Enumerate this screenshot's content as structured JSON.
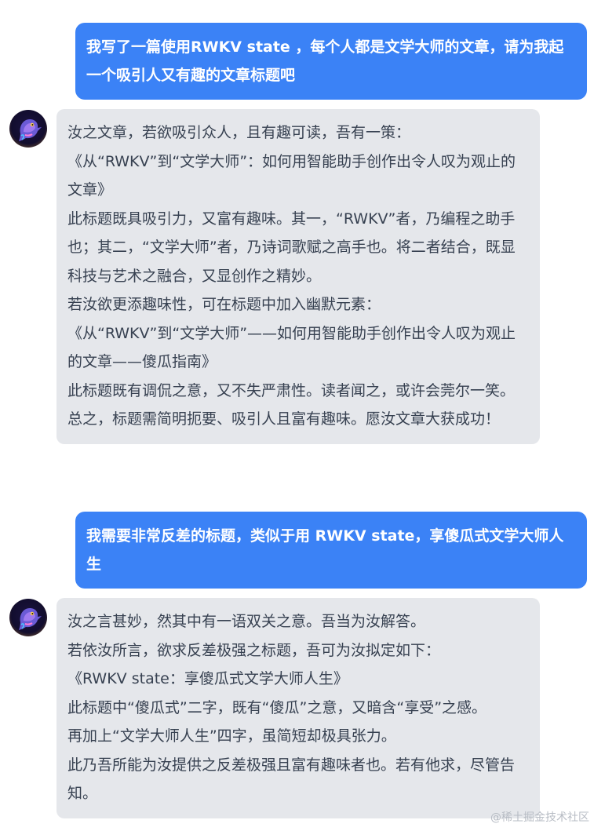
{
  "conversation": {
    "messages": [
      {
        "role": "user",
        "lines": [
          "我写了一篇使用RWKV state ，每个人都是文学大师的文章，请为我起一个吸引人又有趣的文章标题吧"
        ]
      },
      {
        "role": "assistant",
        "avatar_icon": "bird-avatar-icon",
        "lines": [
          "汝之文章，若欲吸引众人，且有趣可读，吾有一策：",
          "《从“RWKV”到“文学大师”：如何用智能助手创作出令人叹为观止的文章》",
          "此标题既具吸引力，又富有趣味。其一，“RWKV”者，乃编程之助手也；其二，“文学大师”者，乃诗词歌赋之高手也。将二者结合，既显科技与艺术之融合，又显创作之精妙。",
          "若汝欲更添趣味性，可在标题中加入幽默元素：",
          "《从“RWKV”到“文学大师”——如何用智能助手创作出令人叹为观止的文章——傻瓜指南》",
          "此标题既有调侃之意，又不失严肃性。读者闻之，或许会莞尔一笑。",
          "总之，标题需简明扼要、吸引人且富有趣味。愿汝文章大获成功！"
        ]
      },
      {
        "role": "user",
        "lines": [
          "我需要非常反差的标题，类似于用 RWKV state，享傻瓜式文学大师人生"
        ]
      },
      {
        "role": "assistant",
        "avatar_icon": "bird-avatar-icon",
        "lines": [
          "汝之言甚妙，然其中有一语双关之意。吾当为汝解答。",
          "若依汝所言，欲求反差极强之标题，吾可为汝拟定如下：",
          "《RWKV state：享傻瓜式文学大师人生》",
          "此标题中“傻瓜式”二字，既有“傻瓜”之意，又暗含“享受”之感。",
          "再加上“文学大师人生”四字，虽简短却极具张力。",
          "此乃吾所能为汝提供之反差极强且富有趣味者也。若有他求，尽管告知。"
        ]
      }
    ]
  },
  "watermark": "@稀土掘金技术社区",
  "colors": {
    "user_bubble": "#3b82f6",
    "assistant_bubble": "#e5e7eb",
    "assistant_text": "#374151"
  }
}
